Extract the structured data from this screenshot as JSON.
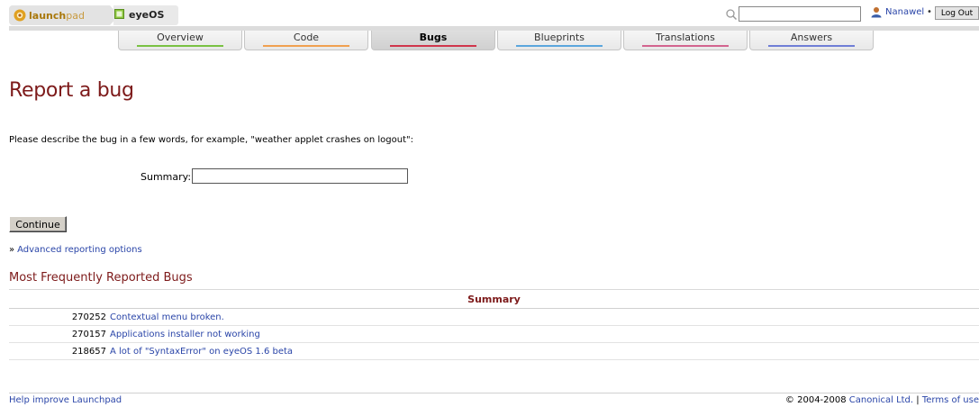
{
  "header": {
    "logo_text_bold": "launch",
    "logo_text_light": "pad",
    "project_name": "eyeOS",
    "search_placeholder": "",
    "user_name": "Nanawel",
    "separator": "•",
    "logout_label": "Log Out"
  },
  "tabs": [
    {
      "label": "Overview",
      "color": "#7ac143",
      "active": false
    },
    {
      "label": "Code",
      "color": "#f0a050",
      "active": false
    },
    {
      "label": "Bugs",
      "color": "#d0354b",
      "active": true
    },
    {
      "label": "Blueprints",
      "color": "#5ba6dd",
      "active": false
    },
    {
      "label": "Translations",
      "color": "#d3648f",
      "active": false
    },
    {
      "label": "Answers",
      "color": "#6f7ed6",
      "active": false
    }
  ],
  "main": {
    "title": "Report a bug",
    "describe_text": "Please describe the bug in a few words, for example, \"weather applet crashes on logout\":",
    "summary_label": "Summary:",
    "summary_value": "",
    "continue_label": "Continue",
    "advanced_marker": "»",
    "advanced_link": "Advanced reporting options"
  },
  "bugs": {
    "section_title": "Most Frequently Reported Bugs",
    "column_header": "Summary",
    "rows": [
      {
        "id": "270252",
        "summary": "Contextual menu broken."
      },
      {
        "id": "270157",
        "summary": "Applications installer not working"
      },
      {
        "id": "218657",
        "summary": "A lot of \"SyntaxError\" on eyeOS 1.6 beta"
      }
    ]
  },
  "footer": {
    "help_link": "Help improve Launchpad",
    "copyright": "© 2004-2008",
    "company_link": "Canonical Ltd.",
    "divider": "|",
    "terms_link": "Terms of use"
  },
  "colors": {
    "title_red": "#7d1a1a",
    "link_blue": "#2a45a8"
  }
}
